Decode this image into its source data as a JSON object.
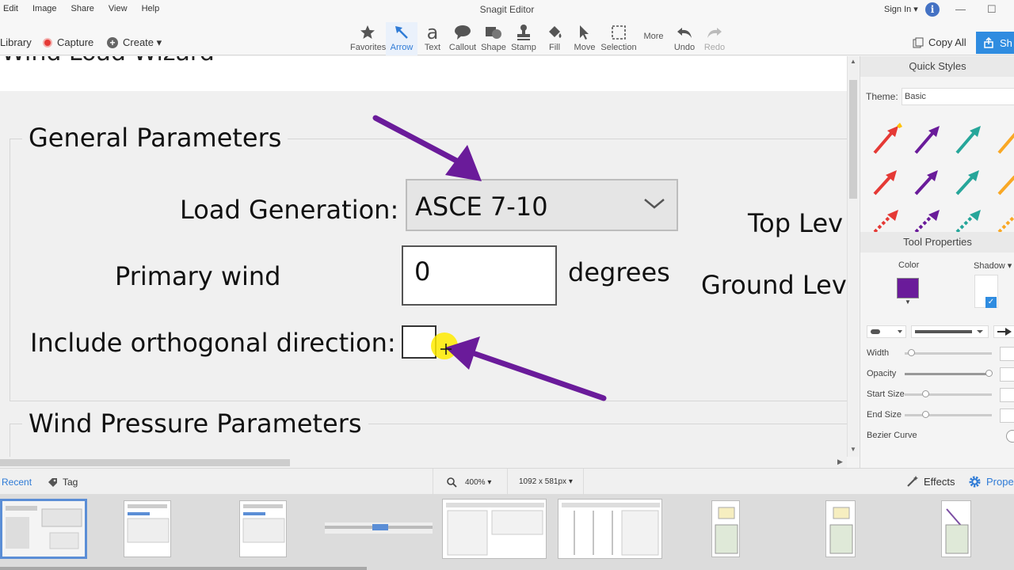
{
  "menu": [
    "Edit",
    "Image",
    "Share",
    "View",
    "Help"
  ],
  "window_title": "Snagit Editor",
  "sign_in": "Sign In ▾",
  "info_glyph": "i",
  "left_nav": {
    "library": "Library",
    "capture": "Capture",
    "create": "Create ▾"
  },
  "tools": [
    {
      "label": "Favorites",
      "icon": "star-icon"
    },
    {
      "label": "Arrow",
      "icon": "arrow-tool-icon",
      "active": true
    },
    {
      "label": "Text",
      "icon": "text-tool-icon",
      "glyph": "a"
    },
    {
      "label": "Callout",
      "icon": "callout-icon"
    },
    {
      "label": "Shape",
      "icon": "shape-icon"
    },
    {
      "label": "Stamp",
      "icon": "stamp-icon"
    },
    {
      "label": "Fill",
      "icon": "fill-icon"
    },
    {
      "label": "Move",
      "icon": "move-icon"
    },
    {
      "label": "Selection",
      "icon": "selection-icon"
    },
    {
      "label": "More",
      "icon": "more-icon"
    },
    {
      "label": "Undo",
      "icon": "undo-icon"
    },
    {
      "label": "Redo",
      "icon": "redo-icon"
    }
  ],
  "copy_all": "Copy All",
  "share_button": "Sh",
  "canvas": {
    "wizard_title": "Wind Load Wizard",
    "general_parameters": "General Parameters",
    "load_generation_label": "Load Generation:",
    "load_generation_value": "ASCE 7-10",
    "primary_wind_label": "Primary wind",
    "primary_wind_value": "0",
    "degrees_label": "degrees",
    "include_orthogonal_label": "Include orthogonal direction:",
    "top_level_label": "Top Lev",
    "ground_level_label": "Ground Lev",
    "wind_pressure_parameters": "Wind Pressure Parameters"
  },
  "right_panel": {
    "quick_styles": "Quick Styles",
    "theme_label": "Theme:",
    "theme_value": "Basic",
    "tool_properties": "Tool Properties",
    "color_label": "Color",
    "color_value": "#6a1b9a",
    "shadow_label": "Shadow ▾",
    "shadow_checked": true,
    "width_label": "Width",
    "opacity_label": "Opacity",
    "start_size_label": "Start Size",
    "end_size_label": "End Size",
    "bezier_label": "Bezier Curve",
    "style_colors": [
      "#e53935",
      "#6a1b9a",
      "#26a69a",
      "#f9a825"
    ]
  },
  "bottom_bar": {
    "recent": "Recent",
    "tag": "Tag",
    "zoom": "400% ▾",
    "dimensions": "1092 x 581px ▾",
    "effects": "Effects",
    "properties": "Prope"
  },
  "colors": {
    "accent": "#2f8ce0",
    "arrow_purple": "#6a1b9a",
    "cursor_highlight": "#ffeb00"
  }
}
